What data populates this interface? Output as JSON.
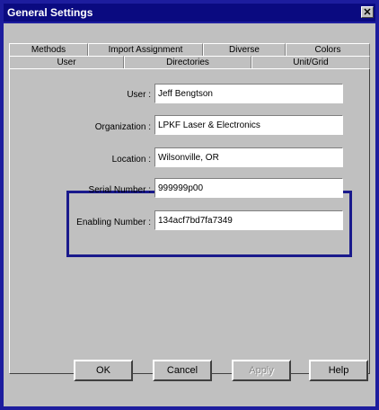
{
  "window": {
    "title": "General Settings",
    "close_glyph": "✕"
  },
  "tabs": {
    "back_row": [
      "Methods",
      "Import Assignment",
      "Diverse",
      "Colors"
    ],
    "front_row": [
      "User",
      "Directories",
      "Unit/Grid"
    ],
    "active": "User"
  },
  "fields": {
    "user": {
      "label": "User :",
      "value": "Jeff Bengtson"
    },
    "organization": {
      "label": "Organization :",
      "value": "LPKF Laser & Electronics"
    },
    "location": {
      "label": "Location :",
      "value": "Wilsonville, OR"
    },
    "serial_number": {
      "label": "Serial Number :",
      "value": "999999p00"
    },
    "enabling_number": {
      "label": "Enabling Number :",
      "value": "134acf7bd7fa7349"
    }
  },
  "buttons": {
    "ok": "OK",
    "cancel": "Cancel",
    "apply": "Apply",
    "help": "Help"
  },
  "colors": {
    "background": "#1d1d9e",
    "highlight_border": "#1a1a8c",
    "dialog_face": "#c0c0c0"
  }
}
